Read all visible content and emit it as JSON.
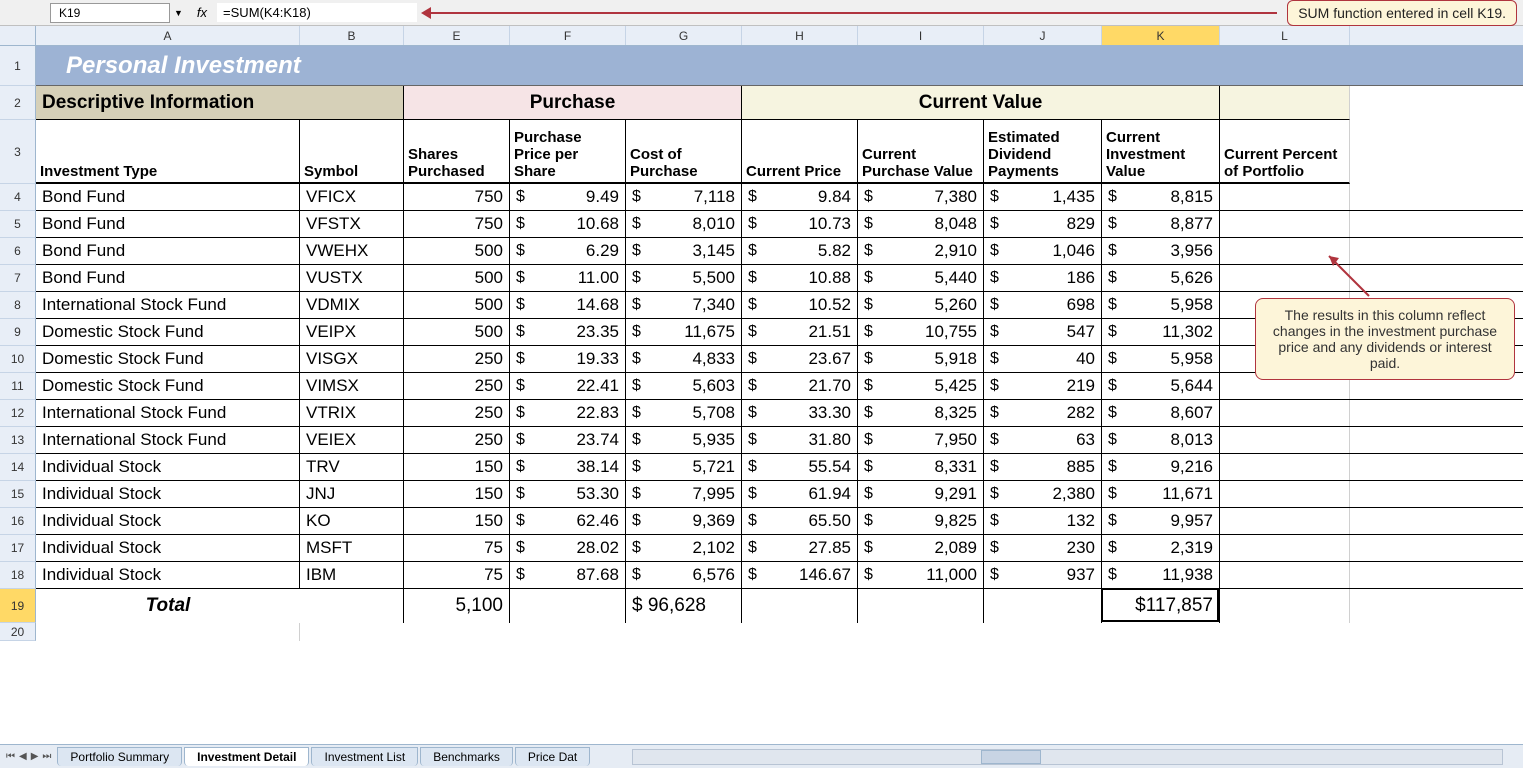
{
  "namebox": "K19",
  "fx": "fx",
  "formula": "=SUM(K4:K18)",
  "callout_top": "SUM function entered in cell K19.",
  "callout_right": "The results in this column reflect changes in the investment purchase price and any dividends or interest paid.",
  "cols": [
    "A",
    "B",
    "E",
    "F",
    "G",
    "H",
    "I",
    "J",
    "K",
    "L"
  ],
  "title": "Personal Investment",
  "sections": {
    "desc": "Descriptive Information",
    "pur": "Purchase",
    "cur": "Current Value"
  },
  "headers": {
    "A": "Investment Type",
    "B": "Symbol",
    "E": "Shares Purchased",
    "F": "Purchase Price per Share",
    "G": "Cost of Purchase",
    "H": "Current Price",
    "I": "Current Purchase Value",
    "J": "Estimated Dividend Payments",
    "K": "Current Investment Value",
    "L": "Current Percent of Portfolio"
  },
  "rows": [
    {
      "n": 4,
      "A": "Bond Fund",
      "B": "VFICX",
      "E": "750",
      "F": "9.49",
      "G": "7,118",
      "H": "9.84",
      "I": "7,380",
      "J": "1,435",
      "K": "8,815"
    },
    {
      "n": 5,
      "A": "Bond Fund",
      "B": "VFSTX",
      "E": "750",
      "F": "10.68",
      "G": "8,010",
      "H": "10.73",
      "I": "8,048",
      "J": "829",
      "K": "8,877"
    },
    {
      "n": 6,
      "A": "Bond Fund",
      "B": "VWEHX",
      "E": "500",
      "F": "6.29",
      "G": "3,145",
      "H": "5.82",
      "I": "2,910",
      "J": "1,046",
      "K": "3,956"
    },
    {
      "n": 7,
      "A": "Bond Fund",
      "B": "VUSTX",
      "E": "500",
      "F": "11.00",
      "G": "5,500",
      "H": "10.88",
      "I": "5,440",
      "J": "186",
      "K": "5,626"
    },
    {
      "n": 8,
      "A": "International Stock Fund",
      "B": "VDMIX",
      "E": "500",
      "F": "14.68",
      "G": "7,340",
      "H": "10.52",
      "I": "5,260",
      "J": "698",
      "K": "5,958"
    },
    {
      "n": 9,
      "A": "Domestic Stock Fund",
      "B": "VEIPX",
      "E": "500",
      "F": "23.35",
      "G": "11,675",
      "H": "21.51",
      "I": "10,755",
      "J": "547",
      "K": "11,302"
    },
    {
      "n": 10,
      "A": "Domestic Stock Fund",
      "B": "VISGX",
      "E": "250",
      "F": "19.33",
      "G": "4,833",
      "H": "23.67",
      "I": "5,918",
      "J": "40",
      "K": "5,958"
    },
    {
      "n": 11,
      "A": "Domestic Stock Fund",
      "B": "VIMSX",
      "E": "250",
      "F": "22.41",
      "G": "5,603",
      "H": "21.70",
      "I": "5,425",
      "J": "219",
      "K": "5,644"
    },
    {
      "n": 12,
      "A": "International Stock Fund",
      "B": "VTRIX",
      "E": "250",
      "F": "22.83",
      "G": "5,708",
      "H": "33.30",
      "I": "8,325",
      "J": "282",
      "K": "8,607"
    },
    {
      "n": 13,
      "A": "International Stock Fund",
      "B": "VEIEX",
      "E": "250",
      "F": "23.74",
      "G": "5,935",
      "H": "31.80",
      "I": "7,950",
      "J": "63",
      "K": "8,013"
    },
    {
      "n": 14,
      "A": "Individual Stock",
      "B": "TRV",
      "E": "150",
      "F": "38.14",
      "G": "5,721",
      "H": "55.54",
      "I": "8,331",
      "J": "885",
      "K": "9,216"
    },
    {
      "n": 15,
      "A": "Individual Stock",
      "B": "JNJ",
      "E": "150",
      "F": "53.30",
      "G": "7,995",
      "H": "61.94",
      "I": "9,291",
      "J": "2,380",
      "K": "11,671"
    },
    {
      "n": 16,
      "A": "Individual Stock",
      "B": "KO",
      "E": "150",
      "F": "62.46",
      "G": "9,369",
      "H": "65.50",
      "I": "9,825",
      "J": "132",
      "K": "9,957"
    },
    {
      "n": 17,
      "A": "Individual Stock",
      "B": "MSFT",
      "E": "75",
      "F": "28.02",
      "G": "2,102",
      "H": "27.85",
      "I": "2,089",
      "J": "230",
      "K": "2,319"
    },
    {
      "n": 18,
      "A": "Individual Stock",
      "B": "IBM",
      "E": "75",
      "F": "87.68",
      "G": "6,576",
      "H": "146.67",
      "I": "11,000",
      "J": "937",
      "K": "11,938"
    }
  ],
  "total": {
    "label": "Total",
    "E": "5,100",
    "G": "$ 96,628",
    "K": "$117,857"
  },
  "tabs": [
    "Portfolio Summary",
    "Investment Detail",
    "Investment List",
    "Benchmarks",
    "Price Dat"
  ],
  "active_tab": 1
}
